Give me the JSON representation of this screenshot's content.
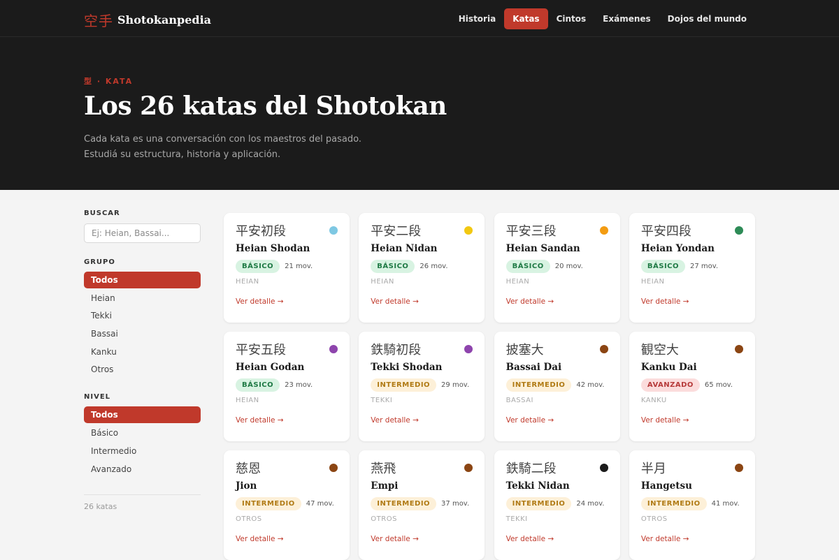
{
  "brand": {
    "kanji": "空手",
    "name": "Shotokanpedia"
  },
  "nav": [
    {
      "label": "Historia",
      "active": false
    },
    {
      "label": "Katas",
      "active": true
    },
    {
      "label": "Cintos",
      "active": false
    },
    {
      "label": "Exámenes",
      "active": false
    },
    {
      "label": "Dojos del mundo",
      "active": false
    }
  ],
  "hero": {
    "eyebrow": "型 · KATA",
    "title": "Los 26 katas del Shotokan",
    "subtitle": "Cada kata es una conversación con los maestros del pasado. Estudiá su estructura, historia y aplicación."
  },
  "sidebar": {
    "search_label": "BUSCAR",
    "search_placeholder": "Ej: Heian, Bassai...",
    "search_value": "",
    "group_label": "GRUPO",
    "groups": [
      {
        "label": "Todos",
        "active": true
      },
      {
        "label": "Heian",
        "active": false
      },
      {
        "label": "Tekki",
        "active": false
      },
      {
        "label": "Bassai",
        "active": false
      },
      {
        "label": "Kanku",
        "active": false
      },
      {
        "label": "Otros",
        "active": false
      }
    ],
    "level_label": "NIVEL",
    "levels": [
      {
        "label": "Todos",
        "active": true
      },
      {
        "label": "Básico",
        "active": false
      },
      {
        "label": "Intermedio",
        "active": false
      },
      {
        "label": "Avanzado",
        "active": false
      }
    ],
    "count": "26 katas"
  },
  "cards": [
    {
      "kanji": "平安初段",
      "name": "Heian Shodan",
      "level": "BÁSICO",
      "level_class": "basico",
      "moves": "21 mov.",
      "group": "HEIAN",
      "dot": "#7ec8e3",
      "link": "Ver detalle →"
    },
    {
      "kanji": "平安二段",
      "name": "Heian Nidan",
      "level": "BÁSICO",
      "level_class": "basico",
      "moves": "26 mov.",
      "group": "HEIAN",
      "dot": "#f2c811",
      "link": "Ver detalle →"
    },
    {
      "kanji": "平安三段",
      "name": "Heian Sandan",
      "level": "BÁSICO",
      "level_class": "basico",
      "moves": "20 mov.",
      "group": "HEIAN",
      "dot": "#f39c12",
      "link": "Ver detalle →"
    },
    {
      "kanji": "平安四段",
      "name": "Heian Yondan",
      "level": "BÁSICO",
      "level_class": "basico",
      "moves": "27 mov.",
      "group": "HEIAN",
      "dot": "#2e8b57",
      "link": "Ver detalle →"
    },
    {
      "kanji": "平安五段",
      "name": "Heian Godan",
      "level": "BÁSICO",
      "level_class": "basico",
      "moves": "23 mov.",
      "group": "HEIAN",
      "dot": "#8e44ad",
      "link": "Ver detalle →"
    },
    {
      "kanji": "鉄騎初段",
      "name": "Tekki Shodan",
      "level": "INTERMEDIO",
      "level_class": "intermedio",
      "moves": "29 mov.",
      "group": "TEKKI",
      "dot": "#8e44ad",
      "link": "Ver detalle →"
    },
    {
      "kanji": "披塞大",
      "name": "Bassai Dai",
      "level": "INTERMEDIO",
      "level_class": "intermedio",
      "moves": "42 mov.",
      "group": "BASSAI",
      "dot": "#8b4513",
      "link": "Ver detalle →"
    },
    {
      "kanji": "観空大",
      "name": "Kanku Dai",
      "level": "AVANZADO",
      "level_class": "avanzado",
      "moves": "65 mov.",
      "group": "KANKU",
      "dot": "#8b4513",
      "link": "Ver detalle →"
    },
    {
      "kanji": "慈恩",
      "name": "Jion",
      "level": "INTERMEDIO",
      "level_class": "intermedio",
      "moves": "47 mov.",
      "group": "OTROS",
      "dot": "#8b4513",
      "link": "Ver detalle →"
    },
    {
      "kanji": "燕飛",
      "name": "Empi",
      "level": "INTERMEDIO",
      "level_class": "intermedio",
      "moves": "37 mov.",
      "group": "OTROS",
      "dot": "#8b4513",
      "link": "Ver detalle →"
    },
    {
      "kanji": "鉄騎二段",
      "name": "Tekki Nidan",
      "level": "INTERMEDIO",
      "level_class": "intermedio",
      "moves": "24 mov.",
      "group": "TEKKI",
      "dot": "#1b1b1b",
      "link": "Ver detalle →"
    },
    {
      "kanji": "半月",
      "name": "Hangetsu",
      "level": "INTERMEDIO",
      "level_class": "intermedio",
      "moves": "41 mov.",
      "group": "OTROS",
      "dot": "#8b4513",
      "link": "Ver detalle →"
    }
  ]
}
